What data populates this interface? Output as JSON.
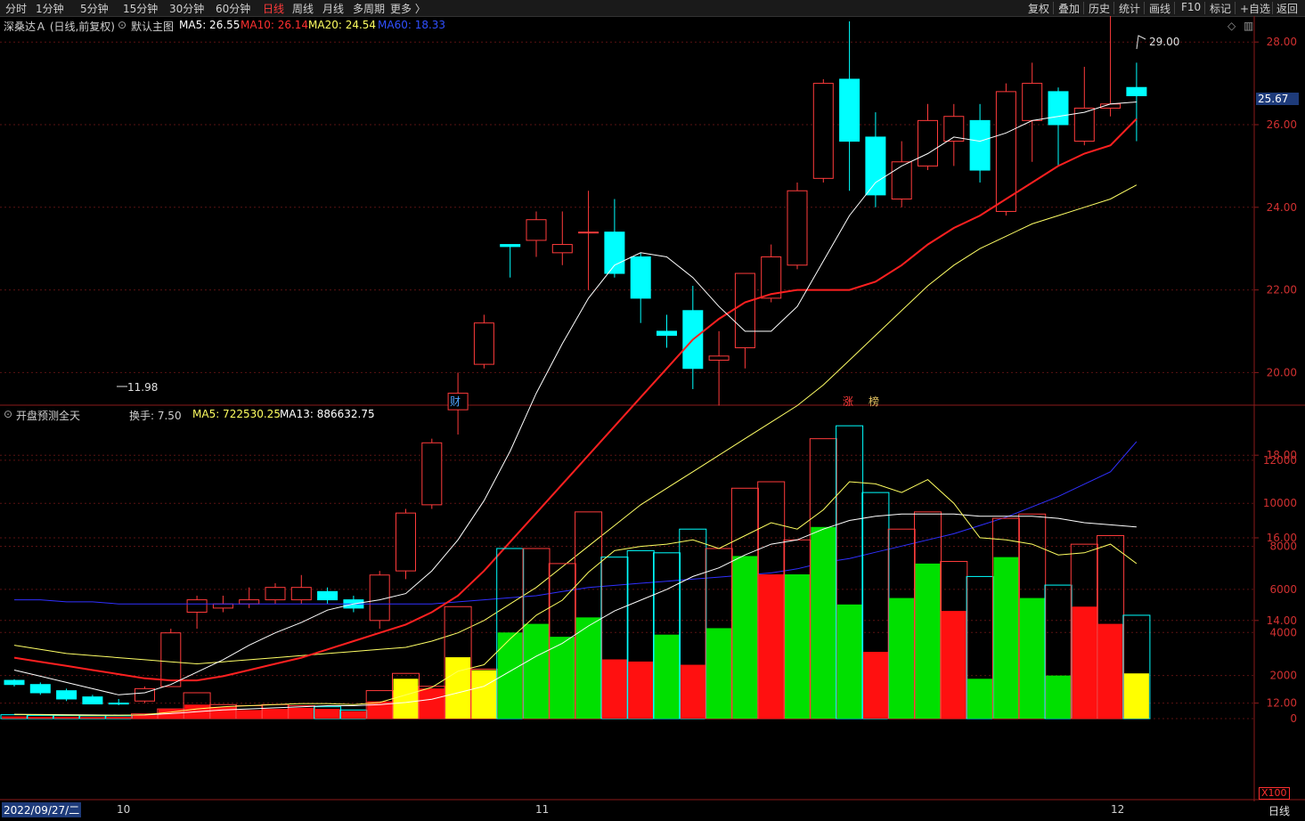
{
  "toolbar": {
    "periods": [
      "分时",
      "1分钟",
      "5分钟",
      "15分钟",
      "30分钟",
      "60分钟",
      "日线",
      "周线",
      "月线",
      "多周期",
      "更多 〉"
    ],
    "active_period": "日线",
    "right_buttons": [
      "复权",
      "叠加",
      "历史",
      "统计",
      "画线",
      "F10",
      "标记",
      "+自选",
      "返回"
    ]
  },
  "main_panel": {
    "stock_name": "深桑达Ａ (日线,前复权)",
    "indicator_name": "默认主图",
    "ma5": "MA5: 26.55",
    "ma10": "MA10: 26.14",
    "ma20": "MA20: 24.54",
    "ma60": "MA60: 18.33",
    "high_label": "29.00",
    "low_label": "11.98",
    "current_price": "25.67",
    "event_markers": [
      {
        "text": "财",
        "color": "#4da3ff"
      },
      {
        "text": "涨",
        "color": "#ff3b3b"
      },
      {
        "text": "榜",
        "color": "#e0c060"
      }
    ]
  },
  "sub_panel": {
    "indicator_name": "开盘预测全天",
    "turnover": "换手: 7.50",
    "ma5": "MA5: 722530.25",
    "ma13": "MA13: 886632.75",
    "unit": "X100"
  },
  "bottom": {
    "date_cursor": "2022/09/27/二",
    "month_labels": [
      "10",
      "11",
      "12"
    ],
    "period": "日线"
  },
  "colors": {
    "up": "#ff3b3b",
    "down": "#00ffff",
    "ma5": "#ffffff",
    "ma10": "#ff2020",
    "ma20": "#ffff66",
    "ma60": "#3030ff",
    "vol_green": "#00e000",
    "vol_yellow": "#ffff00",
    "vol_red": "#ff1010"
  },
  "chart_data": [
    {
      "type": "candlestick",
      "y_ticks": [
        "12.00",
        "14.00",
        "16.00",
        "18.00",
        "20.00",
        "22.00",
        "24.00",
        "26.00",
        "28.00"
      ],
      "ylim": [
        11.2,
        29.5
      ],
      "candles": [
        [
          12.55,
          12.58,
          12.45,
          12.4
        ],
        [
          12.45,
          12.5,
          12.25,
          12.2
        ],
        [
          12.3,
          12.35,
          12.1,
          12.05
        ],
        [
          12.15,
          12.2,
          11.98,
          11.98
        ],
        [
          12.0,
          12.1,
          11.98,
          11.95
        ],
        [
          12.05,
          12.4,
          12.35,
          12.0
        ],
        [
          12.4,
          13.8,
          13.7,
          12.4
        ],
        [
          14.2,
          14.6,
          14.5,
          13.8
        ],
        [
          14.3,
          14.6,
          14.4,
          14.2
        ],
        [
          14.4,
          14.8,
          14.5,
          14.3
        ],
        [
          14.5,
          14.9,
          14.8,
          14.4
        ],
        [
          14.5,
          15.1,
          14.8,
          14.4
        ],
        [
          14.7,
          14.8,
          14.5,
          14.4
        ],
        [
          14.5,
          14.6,
          14.3,
          14.2
        ],
        [
          14.0,
          15.2,
          15.1,
          13.8
        ],
        [
          15.2,
          16.7,
          16.6,
          15.0
        ],
        [
          16.8,
          18.4,
          18.3,
          16.7
        ],
        [
          19.1,
          20.0,
          19.5,
          18.5
        ],
        [
          20.2,
          21.4,
          21.2,
          20.1
        ],
        [
          23.1,
          23.1,
          23.05,
          22.3
        ],
        [
          23.2,
          23.9,
          23.7,
          22.8
        ],
        [
          22.9,
          23.9,
          23.1,
          22.6
        ],
        [
          23.4,
          24.4,
          23.4,
          22.0
        ],
        [
          23.4,
          24.2,
          22.4,
          22.3
        ],
        [
          22.8,
          22.9,
          21.8,
          21.2
        ],
        [
          21.0,
          21.4,
          20.9,
          20.6
        ],
        [
          21.5,
          22.1,
          20.1,
          19.6
        ],
        [
          20.3,
          21.0,
          20.4,
          19.2
        ],
        [
          20.6,
          21.7,
          22.4,
          20.1
        ],
        [
          21.8,
          23.1,
          22.8,
          21.7
        ],
        [
          22.6,
          24.6,
          24.4,
          22.5
        ],
        [
          24.7,
          27.1,
          27.0,
          24.6
        ],
        [
          27.1,
          28.5,
          25.6,
          24.4
        ],
        [
          25.7,
          26.3,
          24.3,
          24.0
        ],
        [
          24.2,
          25.6,
          25.1,
          24.0
        ],
        [
          25.0,
          26.5,
          26.1,
          24.9
        ],
        [
          25.6,
          26.5,
          26.2,
          25.0
        ],
        [
          26.1,
          26.5,
          24.9,
          24.6
        ],
        [
          23.9,
          27.0,
          26.8,
          23.8
        ],
        [
          26.1,
          27.5,
          27.0,
          25.1
        ],
        [
          26.8,
          26.9,
          26.0,
          25.0
        ],
        [
          25.6,
          27.4,
          26.4,
          25.5
        ],
        [
          26.4,
          28.9,
          26.5,
          26.2
        ],
        [
          26.9,
          27.5,
          26.7,
          25.6
        ]
      ],
      "ma5": [
        12.8,
        12.65,
        12.5,
        12.35,
        12.2,
        12.25,
        12.45,
        12.75,
        13.05,
        13.4,
        13.7,
        13.95,
        14.25,
        14.4,
        14.5,
        14.65,
        15.2,
        15.95,
        16.9,
        18.1,
        19.5,
        20.7,
        21.8,
        22.6,
        22.9,
        22.8,
        22.3,
        21.6,
        21.0,
        21.0,
        21.6,
        22.7,
        23.8,
        24.6,
        25.0,
        25.3,
        25.7,
        25.6,
        25.8,
        26.1,
        26.2,
        26.3,
        26.5,
        26.55
      ],
      "ma10": [
        13.1,
        13.0,
        12.9,
        12.8,
        12.7,
        12.6,
        12.55,
        12.55,
        12.65,
        12.8,
        12.95,
        13.1,
        13.3,
        13.5,
        13.7,
        13.9,
        14.2,
        14.6,
        15.2,
        15.9,
        16.6,
        17.3,
        18.0,
        18.7,
        19.4,
        20.1,
        20.8,
        21.3,
        21.7,
        21.9,
        22.0,
        22.0,
        22.0,
        22.2,
        22.6,
        23.1,
        23.5,
        23.8,
        24.2,
        24.6,
        25.0,
        25.3,
        25.5,
        26.14
      ],
      "ma20": [
        13.4,
        13.3,
        13.2,
        13.15,
        13.1,
        13.05,
        13.0,
        12.95,
        13.0,
        13.05,
        13.1,
        13.15,
        13.2,
        13.25,
        13.3,
        13.35,
        13.5,
        13.7,
        14.0,
        14.4,
        14.8,
        15.3,
        15.8,
        16.3,
        16.8,
        17.2,
        17.6,
        18.0,
        18.4,
        18.8,
        19.2,
        19.7,
        20.3,
        20.9,
        21.5,
        22.1,
        22.6,
        23.0,
        23.3,
        23.6,
        23.8,
        24.0,
        24.2,
        24.54
      ],
      "ma60": [
        14.5,
        14.5,
        14.45,
        14.45,
        14.4,
        14.4,
        14.4,
        14.4,
        14.4,
        14.4,
        14.4,
        14.4,
        14.4,
        14.4,
        14.4,
        14.4,
        14.4,
        14.45,
        14.5,
        14.55,
        14.6,
        14.7,
        14.8,
        14.85,
        14.9,
        14.95,
        15.0,
        15.05,
        15.1,
        15.15,
        15.25,
        15.4,
        15.5,
        15.65,
        15.8,
        15.95,
        16.1,
        16.3,
        16.5,
        16.75,
        17.0,
        17.3,
        17.6,
        18.33
      ]
    },
    {
      "type": "bar",
      "y_ticks": [
        "0",
        "2000",
        "4000",
        "6000",
        "8000",
        "10000",
        "12000"
      ],
      "ylim": [
        0,
        14200
      ],
      "bars": [
        [
          180,
          100,
          "red"
        ],
        [
          150,
          80,
          "red"
        ],
        [
          140,
          80,
          "red"
        ],
        [
          130,
          70,
          "red"
        ],
        [
          130,
          80,
          "red"
        ],
        [
          220,
          160,
          "red"
        ],
        [
          450,
          450,
          "red"
        ],
        [
          1200,
          650,
          "red"
        ],
        [
          650,
          550,
          "red"
        ],
        [
          600,
          400,
          "red"
        ],
        [
          650,
          450,
          "red"
        ],
        [
          600,
          500,
          "red"
        ],
        [
          550,
          450,
          "red"
        ],
        [
          400,
          350,
          "red"
        ],
        [
          1300,
          800,
          "red"
        ],
        [
          2100,
          1850,
          "yellow"
        ],
        [
          1500,
          1400,
          "red"
        ],
        [
          5200,
          2850,
          "yellow"
        ],
        [
          2300,
          2250,
          "yellow"
        ],
        [
          7900,
          4000,
          "green"
        ],
        [
          7900,
          4400,
          "green"
        ],
        [
          7200,
          3800,
          "green"
        ],
        [
          9600,
          4700,
          "green"
        ],
        [
          7500,
          2750,
          "red"
        ],
        [
          7800,
          2650,
          "red"
        ],
        [
          7700,
          3900,
          "green"
        ],
        [
          8800,
          2500,
          "red"
        ],
        [
          7900,
          4200,
          "green"
        ],
        [
          10700,
          7550,
          "green"
        ],
        [
          11000,
          6700,
          "red"
        ],
        [
          8300,
          6700,
          "green"
        ],
        [
          13000,
          8900,
          "green"
        ],
        [
          13600,
          5300,
          "green"
        ],
        [
          10500,
          3100,
          "red"
        ],
        [
          8800,
          5600,
          "green"
        ],
        [
          9600,
          7200,
          "green"
        ],
        [
          7300,
          5000,
          "red"
        ],
        [
          6600,
          1850,
          "green"
        ],
        [
          9300,
          7500,
          "green"
        ],
        [
          9500,
          5600,
          "green"
        ],
        [
          6200,
          2000,
          "green"
        ],
        [
          8100,
          5200,
          "red"
        ],
        [
          8500,
          4400,
          "red"
        ],
        [
          4800,
          2100,
          "yellow"
        ]
      ],
      "ma5_line": [
        200,
        180,
        160,
        150,
        150,
        180,
        300,
        450,
        550,
        600,
        650,
        700,
        700,
        650,
        750,
        1100,
        1450,
        2200,
        2500,
        3700,
        4800,
        5500,
        6800,
        7800,
        8000,
        8100,
        8300,
        7900,
        8500,
        9100,
        8800,
        9700,
        11000,
        10900,
        10500,
        11100,
        10000,
        8400,
        8300,
        8100,
        7600,
        7700,
        8100,
        7200
      ],
      "ma13_line": [
        200,
        190,
        180,
        170,
        160,
        170,
        230,
        320,
        400,
        450,
        500,
        550,
        600,
        600,
        650,
        750,
        900,
        1200,
        1500,
        2200,
        2900,
        3500,
        4300,
        5000,
        5500,
        6000,
        6600,
        7000,
        7600,
        8100,
        8300,
        8800,
        9200,
        9400,
        9500,
        9500,
        9500,
        9400,
        9400,
        9400,
        9300,
        9100,
        9000,
        8900
      ]
    }
  ]
}
